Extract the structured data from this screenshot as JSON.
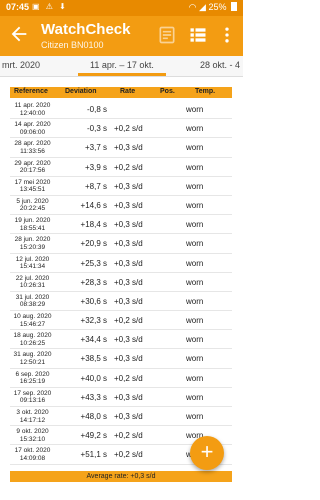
{
  "status": {
    "time": "07:45",
    "battery": "25%"
  },
  "appbar": {
    "title": "WatchCheck",
    "subtitle": "Citizen BN0100"
  },
  "tabs": [
    {
      "label": "mrt. 2020"
    },
    {
      "label": "11 apr. – 17 okt."
    },
    {
      "label": "28 okt. - 4"
    }
  ],
  "table": {
    "headers": [
      "Reference",
      "Deviation",
      "Rate",
      "Pos.",
      "Temp."
    ],
    "rows": [
      {
        "date": "11 apr. 2020",
        "time": "12:40:00",
        "deviation": "-0,8 s",
        "rate": "",
        "temp": "worn"
      },
      {
        "date": "14 apr. 2020",
        "time": "09:06:00",
        "deviation": "-0,3 s",
        "rate": "+0,2 s/d",
        "temp": "worn"
      },
      {
        "date": "28 apr. 2020",
        "time": "11:33:56",
        "deviation": "+3,7 s",
        "rate": "+0,3 s/d",
        "temp": "worn"
      },
      {
        "date": "29 apr. 2020",
        "time": "20:17:56",
        "deviation": "+3,9 s",
        "rate": "+0,2 s/d",
        "temp": "worn"
      },
      {
        "date": "17 mei 2020",
        "time": "13:45:51",
        "deviation": "+8,7 s",
        "rate": "+0,3 s/d",
        "temp": "worn"
      },
      {
        "date": "5 jun. 2020",
        "time": "20:22:45",
        "deviation": "+14,6 s",
        "rate": "+0,3 s/d",
        "temp": "worn"
      },
      {
        "date": "19 jun. 2020",
        "time": "18:55:41",
        "deviation": "+18,4 s",
        "rate": "+0,3 s/d",
        "temp": "worn"
      },
      {
        "date": "28 jun. 2020",
        "time": "15:20:39",
        "deviation": "+20,9 s",
        "rate": "+0,3 s/d",
        "temp": "worn"
      },
      {
        "date": "12 jul. 2020",
        "time": "15:41:34",
        "deviation": "+25,3 s",
        "rate": "+0,3 s/d",
        "temp": "worn"
      },
      {
        "date": "22 jul. 2020",
        "time": "10:26:31",
        "deviation": "+28,3 s",
        "rate": "+0,3 s/d",
        "temp": "worn"
      },
      {
        "date": "31 jul. 2020",
        "time": "08:38:29",
        "deviation": "+30,6 s",
        "rate": "+0,3 s/d",
        "temp": "worn"
      },
      {
        "date": "10 aug. 2020",
        "time": "15:46:27",
        "deviation": "+32,3 s",
        "rate": "+0,2 s/d",
        "temp": "worn"
      },
      {
        "date": "18 aug. 2020",
        "time": "10:26:25",
        "deviation": "+34,4 s",
        "rate": "+0,3 s/d",
        "temp": "worn"
      },
      {
        "date": "31 aug. 2020",
        "time": "12:50:21",
        "deviation": "+38,5 s",
        "rate": "+0,3 s/d",
        "temp": "worn"
      },
      {
        "date": "6 sep. 2020",
        "time": "16:25:19",
        "deviation": "+40,0 s",
        "rate": "+0,2 s/d",
        "temp": "worn"
      },
      {
        "date": "17 sep. 2020",
        "time": "09:13:16",
        "deviation": "+43,3 s",
        "rate": "+0,3 s/d",
        "temp": "worn"
      },
      {
        "date": "3 okt. 2020",
        "time": "14:17:12",
        "deviation": "+48,0 s",
        "rate": "+0,3 s/d",
        "temp": "worn"
      },
      {
        "date": "9 okt. 2020",
        "time": "15:32:10",
        "deviation": "+49,2 s",
        "rate": "+0,2 s/d",
        "temp": "worn"
      },
      {
        "date": "17 okt. 2020",
        "time": "14:09:08",
        "deviation": "+51,1 s",
        "rate": "+0,2 s/d",
        "temp": "worn"
      }
    ],
    "footer": "Average rate: +0,3 s/d"
  },
  "fab": {
    "label": "+"
  },
  "colors": {
    "status_bar": "#e88a00",
    "app_bar": "#f39c12",
    "header": "#f5a31a"
  }
}
